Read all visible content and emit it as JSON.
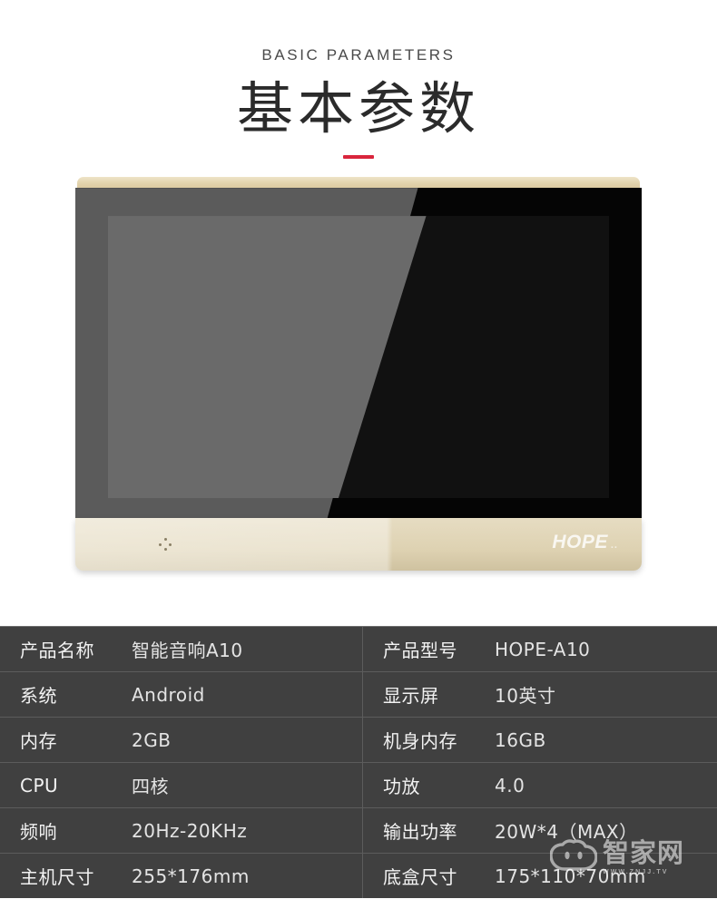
{
  "header": {
    "eyebrow": "BASIC PARAMETERS",
    "title_cn": "基本参数",
    "accent_color": "#d9253c"
  },
  "product_image": {
    "device_brand": "HOPE",
    "brand_tail": "..",
    "mic_icon": "mic-grille-icon",
    "bezel_color": "#e0d4b3",
    "screen_color": "#0a0a0a"
  },
  "spec_table": {
    "background_color": "#404040",
    "divider_color": "#5c5c5c",
    "rows": [
      {
        "left_label": "产品名称",
        "left_value": "智能音响A10",
        "right_label": "产品型号",
        "right_value": "HOPE-A10"
      },
      {
        "left_label": "系统",
        "left_value": "Android",
        "right_label": "显示屏",
        "right_value": "10英寸"
      },
      {
        "left_label": "内存",
        "left_value": "2GB",
        "right_label": "机身内存",
        "right_value": "16GB"
      },
      {
        "left_label": "CPU",
        "left_value": "四核",
        "right_label": "功放",
        "right_value": "4.0"
      },
      {
        "left_label": "频响",
        "left_value": "20Hz-20KHz",
        "right_label": "输出功率",
        "right_value": "20W*4（MAX）"
      },
      {
        "left_label": "主机尺寸",
        "left_value": "255*176mm",
        "right_label": "底盒尺寸",
        "right_value": "175*110*70mm"
      }
    ]
  },
  "watermark": {
    "icon": "cloud-face-icon",
    "text_cn": "智家网",
    "text_en": "WWW.ZNJJ.TV"
  }
}
